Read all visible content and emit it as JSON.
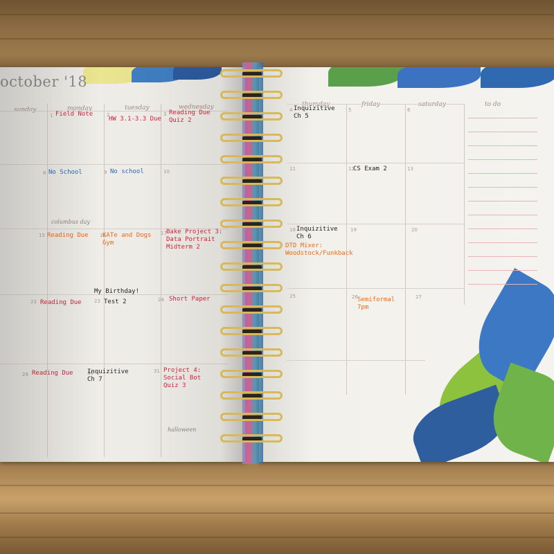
{
  "planner": {
    "month_title": "october '18",
    "days": {
      "sunday": "sunday",
      "monday": "monday",
      "tuesday": "tuesday",
      "wednesday": "wednesday",
      "thursday": "thursday",
      "friday": "friday",
      "saturday": "saturday",
      "todo": "to do"
    },
    "numbers": {
      "n1": "1",
      "n2": "2",
      "n3": "3",
      "n4": "4",
      "n5": "5",
      "n6": "6",
      "n8": "8",
      "n9": "9",
      "n10": "10",
      "n11": "11",
      "n12": "12",
      "n13": "13",
      "n15": "15",
      "n16": "16",
      "n17": "17",
      "n18": "18",
      "n19": "19",
      "n20": "20",
      "n22": "22",
      "n23": "23",
      "n24": "24",
      "n25": "25",
      "n26": "26",
      "n27": "27",
      "n29": "29",
      "n30": "30",
      "n31": "31"
    },
    "holidays": {
      "columbus": "columbus day",
      "halloween": "halloween"
    },
    "entries": {
      "field_note": "Field Note",
      "hw": "HW 3.1-3.3 Due",
      "reading_due_3": "Reading Due\nQuiz 2",
      "inquizitive_4": "Inquizitive\nCh 5",
      "no_school_8": "No School",
      "no_school_9": "No school",
      "cs_exam": "CS Exam 2",
      "reading_due_15": "Reading Due",
      "kate_dogs": "KATe and Dogs\nGym",
      "project3": "Bake Project 3:\nData Portrait\nMidterm 2",
      "inquizitive_18": "Inquizitive\nCh 6",
      "dtd_mixer": "DTD Mixer:\nWoodstock/Funkback",
      "birthday": "My Birthday!",
      "test2": "Test 2",
      "reading_due_22": "Reading Due",
      "short_paper": "Short Paper",
      "semiformal": "Semiformal\n7pm",
      "reading_due_29": "Reading Due",
      "inquizitive_30": "Inquizitive\nCh 7",
      "project4": "Project 4:\nSocial Bot\nQuiz 3"
    }
  }
}
